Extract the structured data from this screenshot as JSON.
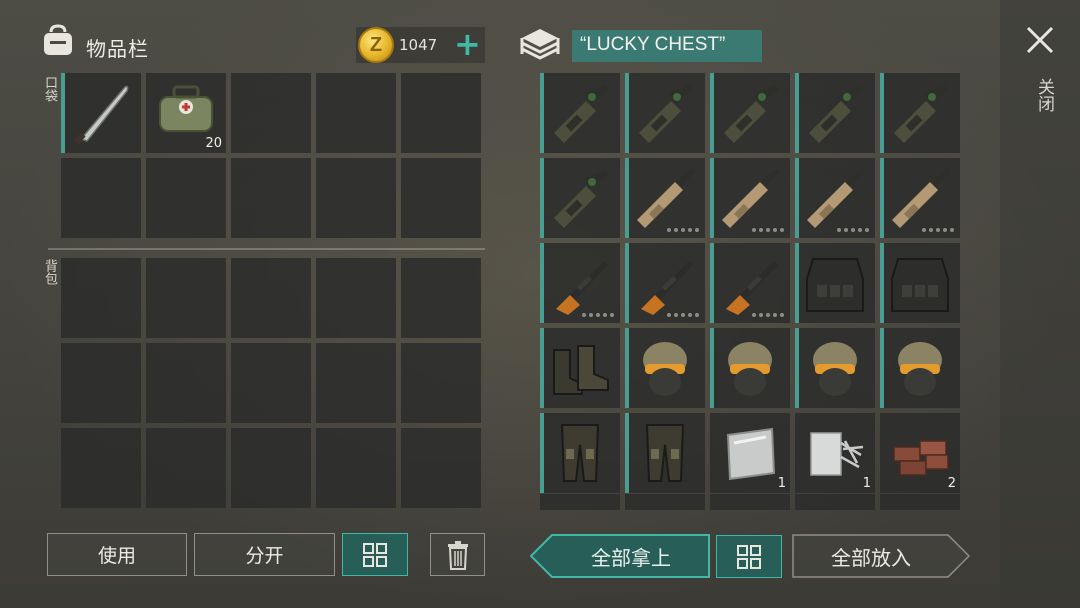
{
  "inventory": {
    "title": "物品栏",
    "currency": {
      "icon": "coin-icon",
      "symbol": "Z",
      "amount": "1047",
      "add_label": "+"
    },
    "pocket_label": "口袋",
    "backpack_label": "背包",
    "pocket_slots": [
      {
        "item": "machete",
        "count": ""
      },
      {
        "item": "medkit-bag",
        "count": "20"
      },
      {
        "item": "",
        "count": ""
      },
      {
        "item": "",
        "count": ""
      },
      {
        "item": "",
        "count": ""
      },
      {
        "item": "",
        "count": ""
      },
      {
        "item": "",
        "count": ""
      },
      {
        "item": "",
        "count": ""
      },
      {
        "item": "",
        "count": ""
      },
      {
        "item": "",
        "count": ""
      }
    ],
    "backpack_slots": 15
  },
  "chest": {
    "icon": "chest-icon",
    "name": "“LUCKY CHEST”",
    "slots": [
      {
        "item": "grenade-launcher",
        "count": ""
      },
      {
        "item": "grenade-launcher",
        "count": ""
      },
      {
        "item": "grenade-launcher",
        "count": ""
      },
      {
        "item": "grenade-launcher",
        "count": ""
      },
      {
        "item": "grenade-launcher",
        "count": ""
      },
      {
        "item": "grenade-launcher",
        "count": ""
      },
      {
        "item": "assault-rifle",
        "count": ""
      },
      {
        "item": "assault-rifle",
        "count": ""
      },
      {
        "item": "assault-rifle",
        "count": ""
      },
      {
        "item": "assault-rifle",
        "count": ""
      },
      {
        "item": "sniper-rifle",
        "count": ""
      },
      {
        "item": "sniper-rifle",
        "count": ""
      },
      {
        "item": "sniper-rifle",
        "count": ""
      },
      {
        "item": "tactical-vest",
        "count": ""
      },
      {
        "item": "tactical-vest",
        "count": ""
      },
      {
        "item": "combat-boots",
        "count": ""
      },
      {
        "item": "helmet",
        "count": ""
      },
      {
        "item": "helmet",
        "count": ""
      },
      {
        "item": "helmet",
        "count": ""
      },
      {
        "item": "helmet",
        "count": ""
      },
      {
        "item": "combat-pants",
        "count": ""
      },
      {
        "item": "combat-pants",
        "count": ""
      },
      {
        "item": "steel-plate",
        "count": "1"
      },
      {
        "item": "nails",
        "count": "1"
      },
      {
        "item": "bricks",
        "count": "2"
      }
    ]
  },
  "close_label": "关闭",
  "buttons": {
    "use": "使用",
    "split": "分开",
    "take_all": "全部拿上",
    "put_all": "全部放入"
  },
  "colors": {
    "accent": "#3fb8a5",
    "selected_bar": "#4a9d92",
    "chest_name_bg": "#3a7a72"
  }
}
